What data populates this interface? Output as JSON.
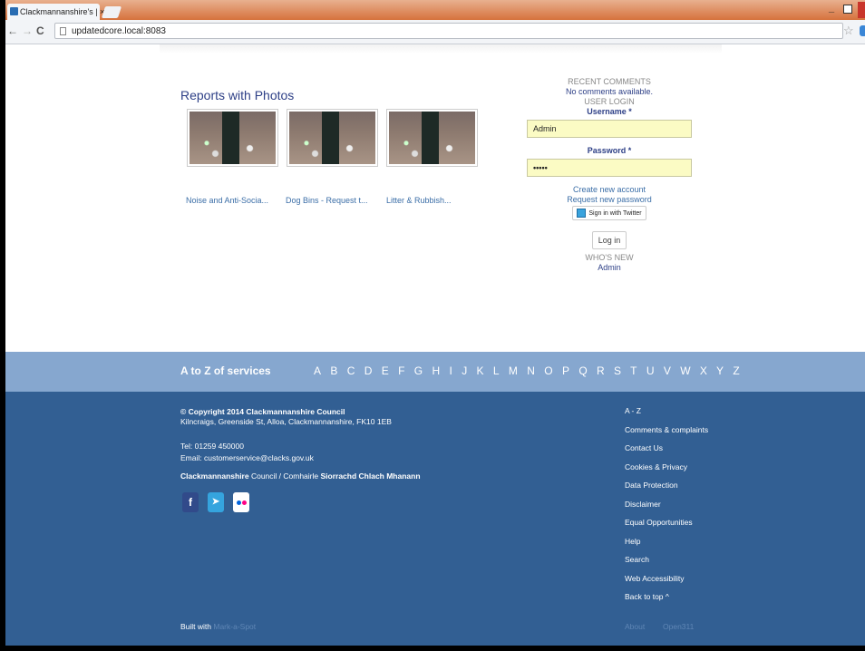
{
  "browser": {
    "tab_title": "Clackmannanshire's | ×",
    "url": "updatedcore.local:8083",
    "nav": {
      "back": "←",
      "forward": "→",
      "reload": "C"
    }
  },
  "reports": {
    "title": "Reports with Photos",
    "items": [
      {
        "caption": "Noise and Anti-Socia..."
      },
      {
        "caption": "Dog Bins - Request t..."
      },
      {
        "caption": "Litter & Rubbish..."
      }
    ]
  },
  "sidebar": {
    "recent_comments_heading": "RECENT COMMENTS",
    "no_comments": "No comments available.",
    "user_login_heading": "USER LOGIN",
    "username_label": "Username *",
    "username_value": "Admin",
    "password_label": "Password *",
    "password_value": "•••••",
    "create_account": "Create new account",
    "request_password": "Request new password",
    "twitter_signin": "Sign in with Twitter",
    "login_button": "Log in",
    "whos_new_heading": "WHO'S NEW",
    "whos_new_user": "Admin"
  },
  "az": {
    "title": "A to Z of services",
    "letters": [
      "A",
      "B",
      "C",
      "D",
      "E",
      "F",
      "G",
      "H",
      "I",
      "J",
      "K",
      "L",
      "M",
      "N",
      "O",
      "P",
      "Q",
      "R",
      "S",
      "T",
      "U",
      "V",
      "W",
      "X",
      "Y",
      "Z"
    ]
  },
  "footer": {
    "copyright": "© Copyright 2014 Clackmannanshire Council",
    "address": "Kilncraigs, Greenside St, Alloa, Clackmannanshire, FK10 1EB",
    "tel": "Tel: 01259 450000",
    "email": "Email: customerservice@clacks.gov.uk",
    "council_1": "Clackmannanshire",
    "council_2": " Council / Comhairle ",
    "council_3": "Siorrachd Chlach Mhanann",
    "links": [
      "A - Z",
      "Comments & complaints",
      "Contact Us",
      "Cookies & Privacy",
      "Data Protection",
      "Disclaimer",
      "Equal Opportunities",
      "Help",
      "Search",
      "Web Accessibility",
      "Back to top ^"
    ],
    "built_with": "Built with ",
    "built_with_link": "Mark-a-Spot",
    "about": "About",
    "open311": "Open311"
  }
}
